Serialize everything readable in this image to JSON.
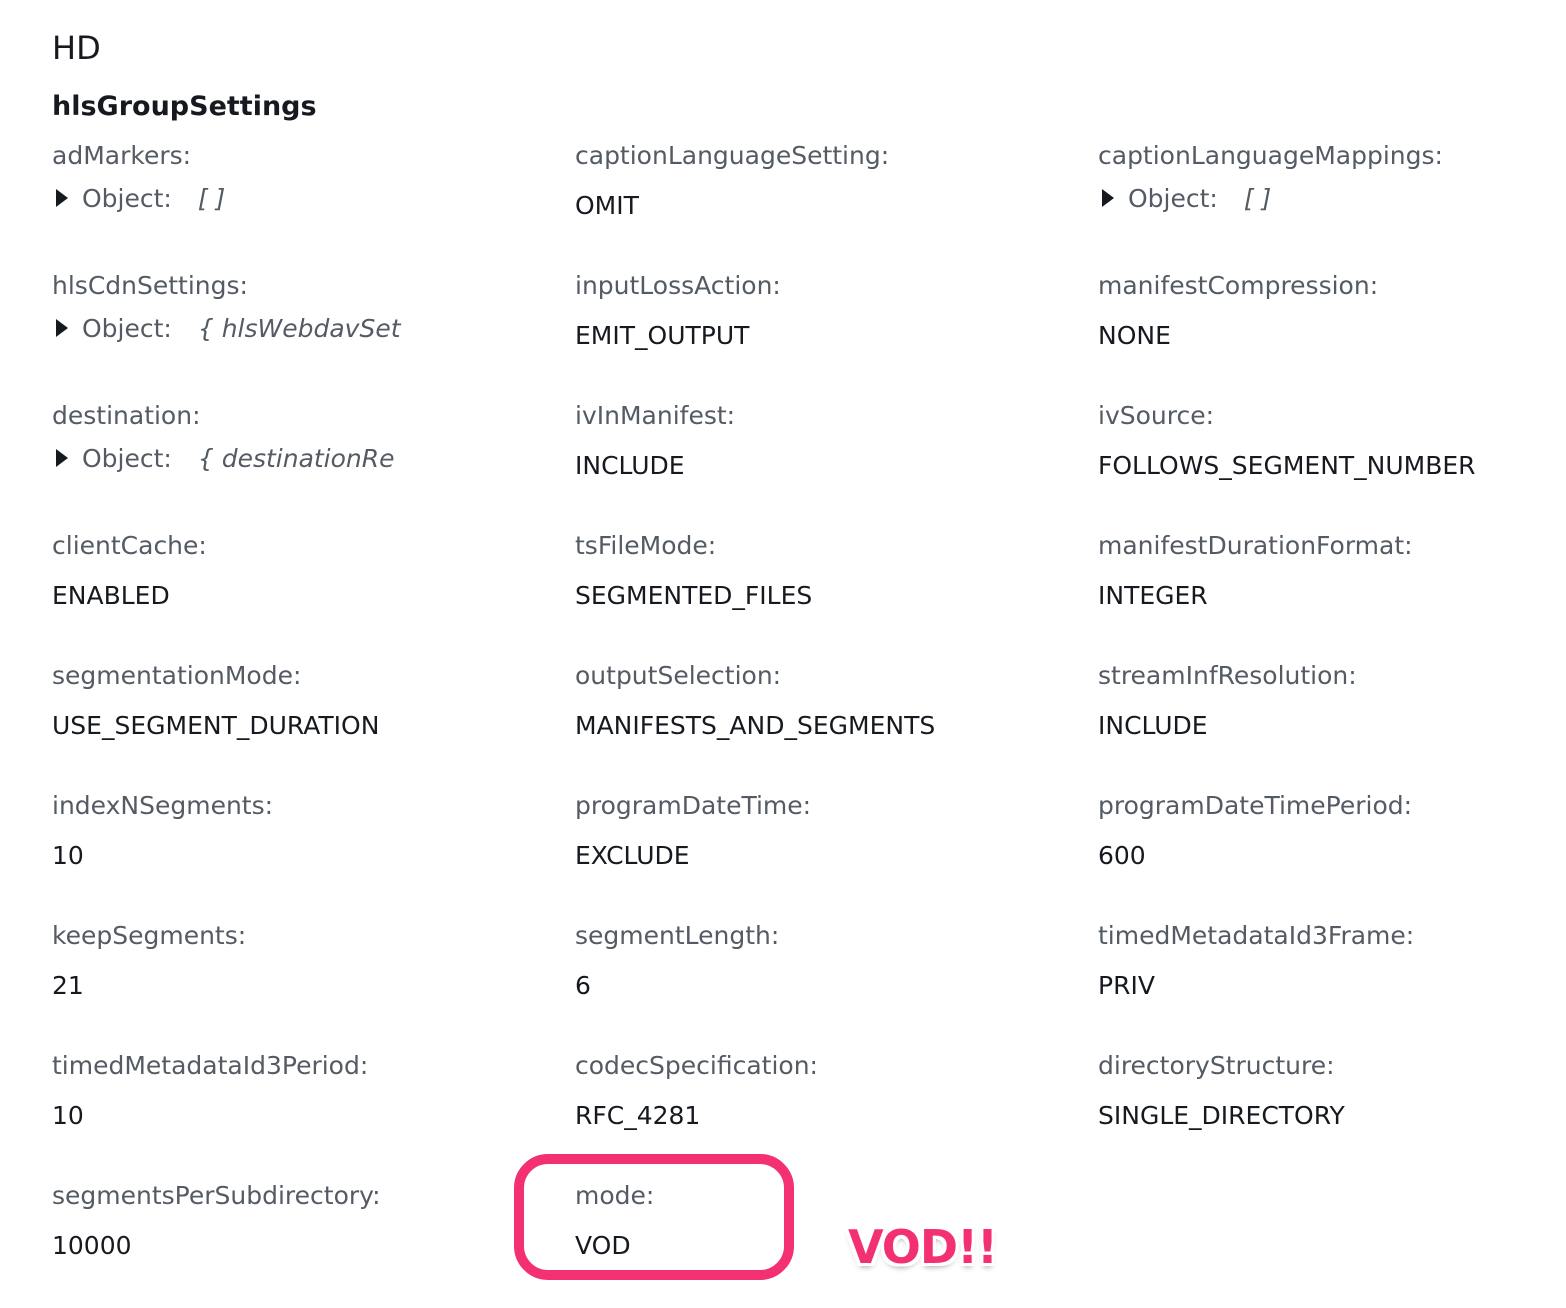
{
  "section_title": "HD",
  "group_title": "hlsGroupSettings",
  "fields": [
    {
      "label": "adMarkers:",
      "type": "object",
      "object_label": "Object:",
      "preview": "[ ]"
    },
    {
      "label": "captionLanguageSetting:",
      "type": "value",
      "value": "OMIT"
    },
    {
      "label": "captionLanguageMappings:",
      "type": "object",
      "object_label": "Object:",
      "preview": "[ ]"
    },
    {
      "label": "hlsCdnSettings:",
      "type": "object",
      "object_label": "Object:",
      "preview": "{ hlsWebdavSet"
    },
    {
      "label": "inputLossAction:",
      "type": "value",
      "value": "EMIT_OUTPUT"
    },
    {
      "label": "manifestCompression:",
      "type": "value",
      "value": "NONE"
    },
    {
      "label": "destination:",
      "type": "object",
      "object_label": "Object:",
      "preview": "{ destinationRe"
    },
    {
      "label": "ivInManifest:",
      "type": "value",
      "value": "INCLUDE"
    },
    {
      "label": "ivSource:",
      "type": "value",
      "value": "FOLLOWS_SEGMENT_NUMBER"
    },
    {
      "label": "clientCache:",
      "type": "value",
      "value": "ENABLED"
    },
    {
      "label": "tsFileMode:",
      "type": "value",
      "value": "SEGMENTED_FILES"
    },
    {
      "label": "manifestDurationFormat:",
      "type": "value",
      "value": "INTEGER"
    },
    {
      "label": "segmentationMode:",
      "type": "value",
      "value": "USE_SEGMENT_DURATION"
    },
    {
      "label": "outputSelection:",
      "type": "value",
      "value": "MANIFESTS_AND_SEGMENTS"
    },
    {
      "label": "streamInfResolution:",
      "type": "value",
      "value": "INCLUDE"
    },
    {
      "label": "indexNSegments:",
      "type": "value",
      "value": "10"
    },
    {
      "label": "programDateTime:",
      "type": "value",
      "value": "EXCLUDE"
    },
    {
      "label": "programDateTimePeriod:",
      "type": "value",
      "value": "600"
    },
    {
      "label": "keepSegments:",
      "type": "value",
      "value": "21"
    },
    {
      "label": "segmentLength:",
      "type": "value",
      "value": "6"
    },
    {
      "label": "timedMetadataId3Frame:",
      "type": "value",
      "value": "PRIV"
    },
    {
      "label": "timedMetadataId3Period:",
      "type": "value",
      "value": "10"
    },
    {
      "label": "codecSpecification:",
      "type": "value",
      "value": "RFC_4281"
    },
    {
      "label": "directoryStructure:",
      "type": "value",
      "value": "SINGLE_DIRECTORY"
    },
    {
      "label": "segmentsPerSubdirectory:",
      "type": "value",
      "value": "10000"
    },
    {
      "label": "mode:",
      "type": "value",
      "value": "VOD"
    }
  ],
  "annotation": {
    "callout_text": "VOD!!",
    "color": "#f33072"
  }
}
